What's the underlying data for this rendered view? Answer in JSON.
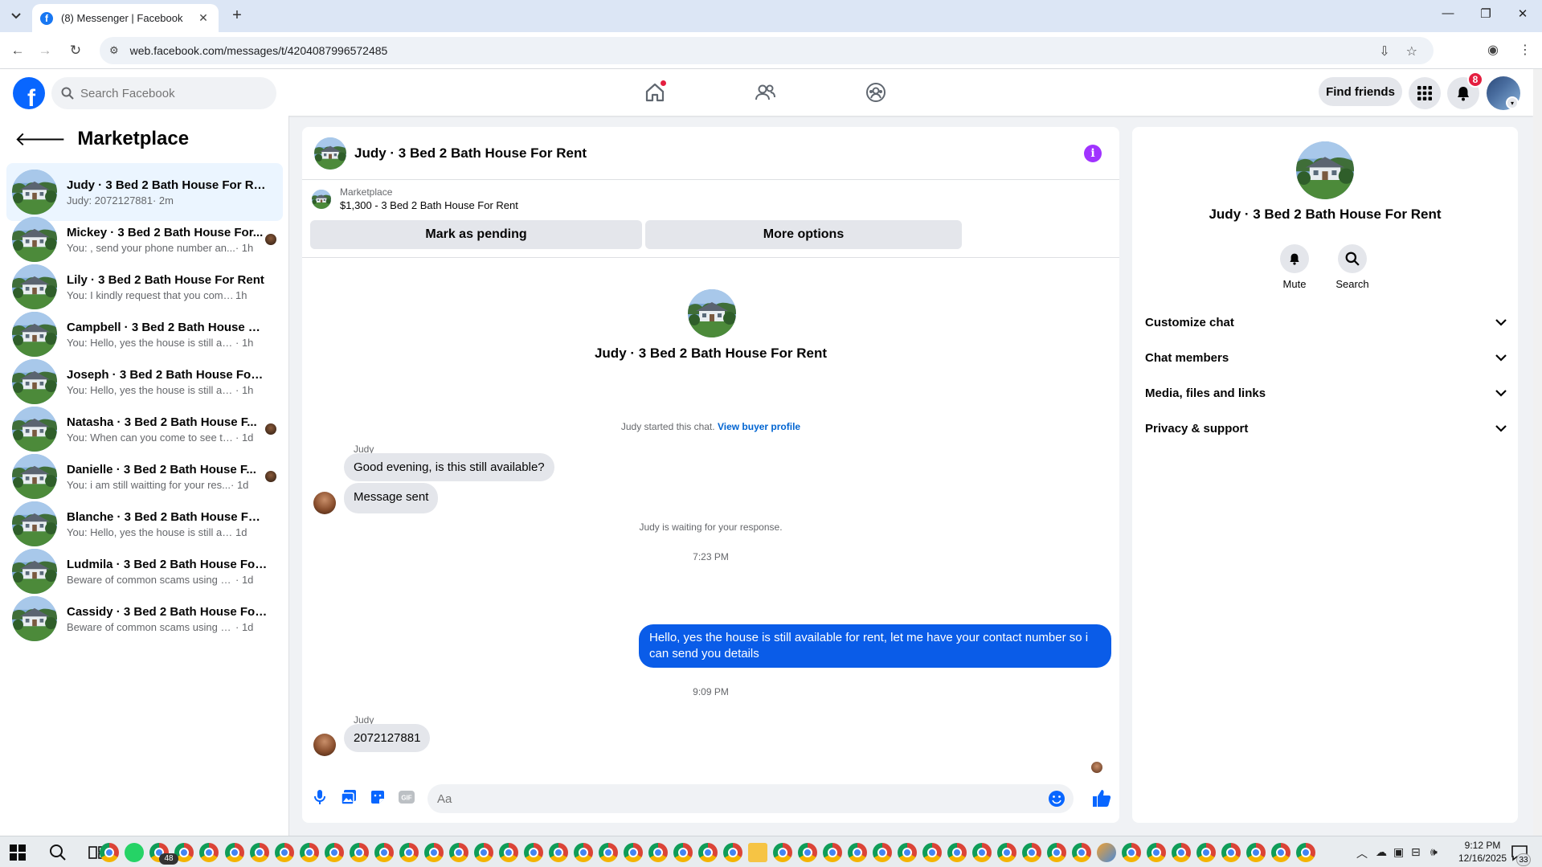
{
  "browser": {
    "tab_title": "(8) Messenger | Facebook",
    "url": "web.facebook.com/messages/t/4204087996572485"
  },
  "header": {
    "search_placeholder": "Search Facebook",
    "find_friends_label": "Find friends",
    "notification_count": "8"
  },
  "sidebar": {
    "title": "Marketplace",
    "conversations": [
      {
        "name": "Judy · 3 Bed 2 Bath House For Rent",
        "preview": "Judy: 2072127881",
        "time": " · 2m",
        "active": true
      },
      {
        "name": "Mickey · 3 Bed 2 Bath House For...",
        "preview": "You: , send your phone number an...",
        "time": " · 1h",
        "seen": true
      },
      {
        "name": "Lily · 3 Bed 2 Bath House For Rent",
        "preview": "You: I kindly request that you complet...",
        "time": " 1h"
      },
      {
        "name": "Campbell · 3 Bed 2 Bath House For...",
        "preview": "You: Hello, yes the house is still availa...",
        "time": " · 1h"
      },
      {
        "name": "Joseph · 3 Bed 2 Bath House For R...",
        "preview": "You: Hello, yes the house is still availa...",
        "time": " · 1h"
      },
      {
        "name": "Natasha · 3 Bed 2 Bath House F...",
        "preview": "You: When can you come to see th...",
        "time": " · 1d",
        "seen": true
      },
      {
        "name": "Danielle · 3 Bed 2 Bath House F...",
        "preview": "You: i am still waitting for your res...",
        "time": " · 1d",
        "seen": true
      },
      {
        "name": "Blanche · 3 Bed 2 Bath House For ...",
        "preview": "You: Hello, yes the house is still availa...",
        "time": " 1d"
      },
      {
        "name": "Ludmila · 3 Bed 2 Bath House For ...",
        "preview": "Beware of common scams using pay...",
        "time": " · 1d"
      },
      {
        "name": "Cassidy · 3 Bed 2 Bath House For R...",
        "preview": "Beware of common scams using pay...",
        "time": " · 1d"
      }
    ]
  },
  "chat": {
    "title": "Judy · 3 Bed 2 Bath House For Rent",
    "listing_category": "Marketplace",
    "listing_title": "$1,300 - 3 Bed 2 Bath House For Rent",
    "mark_pending_label": "Mark as pending",
    "more_options_label": "More options",
    "profile_name": "Judy · 3 Bed 2 Bath House For Rent",
    "started_text": "Judy started this chat.",
    "view_buyer_profile": "View buyer profile",
    "sender_name": "Judy",
    "msg1": "Good evening, is this still available?",
    "msg2": "Message sent",
    "waiting_text": "Judy is waiting for your response.",
    "time1": "7:23 PM",
    "outgoing": "Hello, yes the house is still available for rent, let me have your contact number so i can send you  details",
    "time2": "9:09 PM",
    "sender_name2": "Judy",
    "msg3": "2072127881",
    "composer_placeholder": "Aa"
  },
  "info_panel": {
    "name": "Judy · 3 Bed 2 Bath House For Rent",
    "mute_label": "Mute",
    "search_label": "Search",
    "sections": [
      "Customize chat",
      "Chat members",
      "Media, files and links",
      "Privacy & support"
    ]
  },
  "taskbar": {
    "time": "9:12 PM",
    "date": "12/16/2025",
    "whatsapp_badge": "48",
    "notification_badge": "33"
  },
  "colors": {
    "facebook_blue": "#0866ff",
    "outgoing_bubble": "#0a5ce8",
    "info_purple": "#a033ff",
    "badge_red": "#e41e3f",
    "active_conversation": "#ebf5ff"
  }
}
